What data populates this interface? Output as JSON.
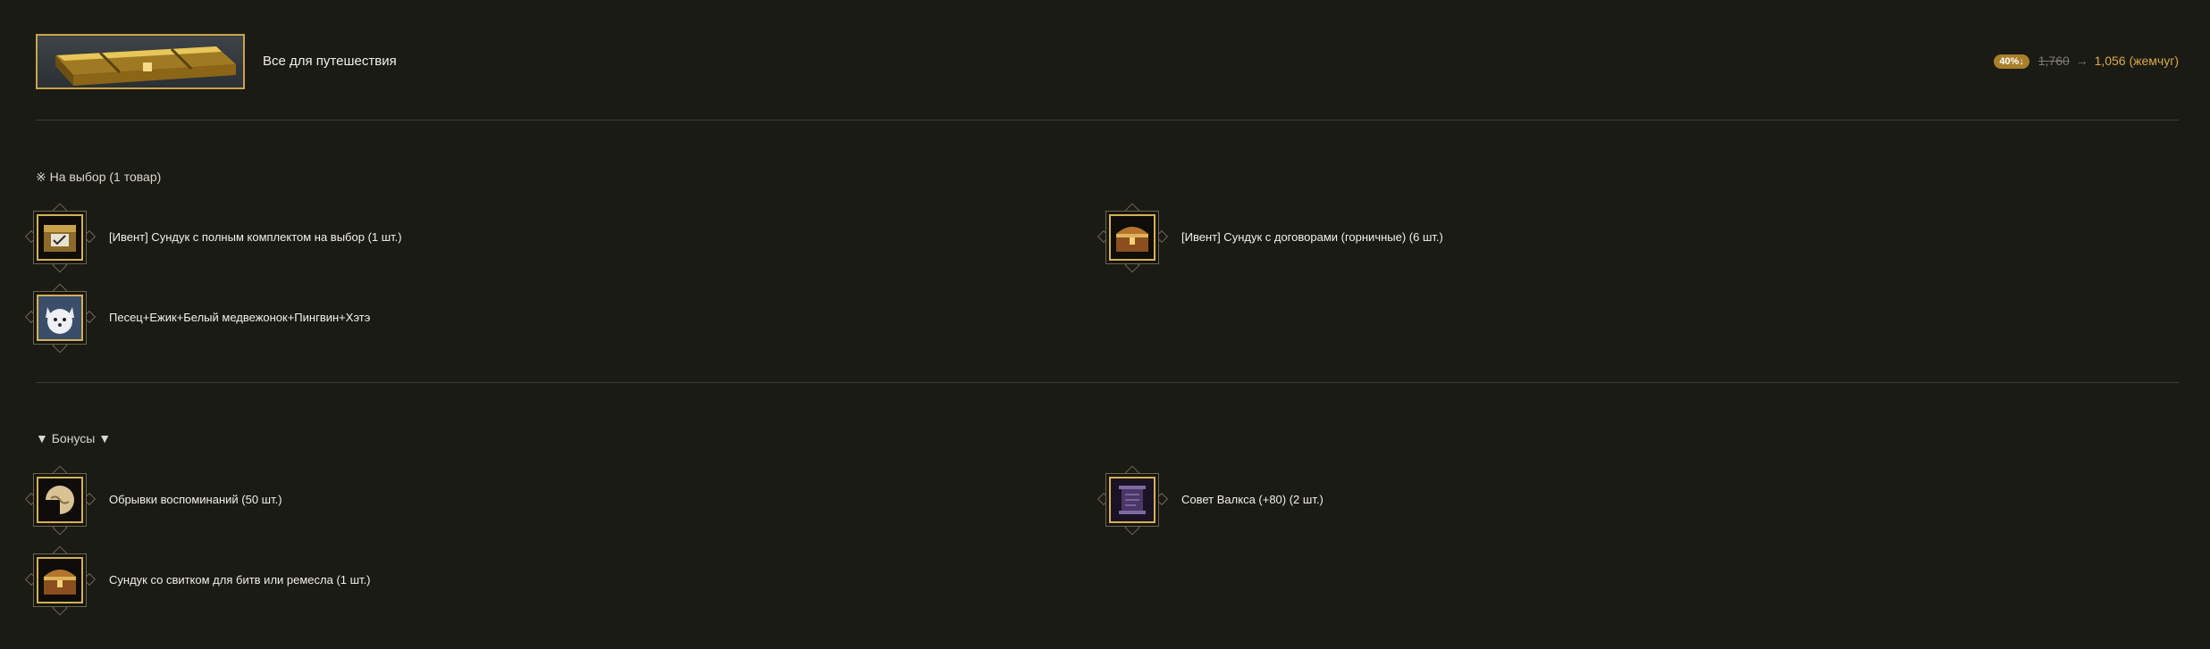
{
  "header": {
    "title": "Все для путешествия",
    "discount_badge": "40%↓",
    "old_price": "1,760",
    "arrow": "→",
    "new_price": "1,056 (жемчуг)"
  },
  "choice_section": {
    "title": "※ На выбор (1 товар)",
    "items": [
      {
        "label": "[Ивент] Сундук с полным комплектом на выбор (1 шт.)",
        "icon": "chest-selection-icon"
      },
      {
        "label": "[Ивент] Сундук с договорами (горничные) (6 шт.)",
        "icon": "treasure-chest-icon"
      },
      {
        "label": "Песец+Ежик+Белый медвежонок+Пингвин+Хэтэ",
        "icon": "arctic-fox-icon"
      }
    ]
  },
  "bonus_section": {
    "title": "▼ Бонусы ▼",
    "items": [
      {
        "label": "Обрывки воспоминаний (50 шт.)",
        "icon": "memory-fragment-icon"
      },
      {
        "label": "Совет Валкса (+80) (2 шт.)",
        "icon": "valks-scroll-icon"
      },
      {
        "label": "Сундук со свитком для битв или ремесла (1 шт.)",
        "icon": "treasure-chest-icon"
      }
    ]
  }
}
